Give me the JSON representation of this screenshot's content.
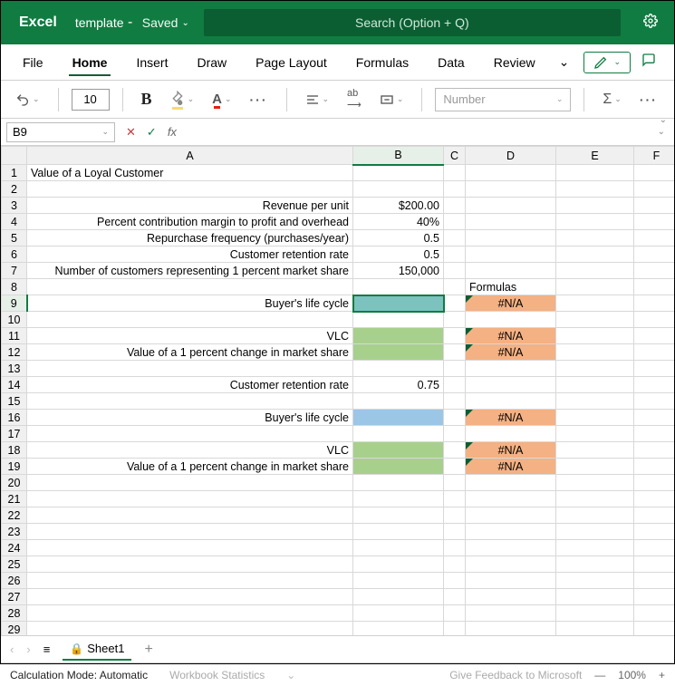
{
  "app": "Excel",
  "doc": {
    "name": "template",
    "status": "Saved"
  },
  "search": {
    "placeholder": "Search (Option + Q)"
  },
  "tabs": [
    "File",
    "Home",
    "Insert",
    "Draw",
    "Page Layout",
    "Formulas",
    "Data",
    "Review"
  ],
  "active_tab": "Home",
  "toolbar": {
    "font_size": "10",
    "number_format": "Number"
  },
  "name_box": "B9",
  "formula": "",
  "columns": [
    "A",
    "B",
    "C",
    "D",
    "E",
    "F"
  ],
  "rows": [
    {
      "n": 1,
      "A": "Value of a Loyal Customer"
    },
    {
      "n": 2
    },
    {
      "n": 3,
      "A": "Revenue per unit",
      "B": "$200.00",
      "ra": true
    },
    {
      "n": 4,
      "A": "Percent contribution margin to profit and overhead",
      "B": "40%",
      "ra": true
    },
    {
      "n": 5,
      "A": "Repurchase frequency (purchases/year)",
      "B": "0.5",
      "ra": true
    },
    {
      "n": 6,
      "A": "Customer retention rate",
      "B": "0.5",
      "ra": true
    },
    {
      "n": 7,
      "A": "Number of customers representing 1 percent market share",
      "B": "150,000",
      "ra": true
    },
    {
      "n": 8,
      "D": "Formulas"
    },
    {
      "n": 9,
      "A": "Buyer's life cycle",
      "ra": true,
      "B_fill": "teal",
      "D": "#N/A",
      "D_fill": "orange"
    },
    {
      "n": 10
    },
    {
      "n": 11,
      "A": "VLC",
      "ra": true,
      "B_fill": "green",
      "D": "#N/A",
      "D_fill": "orange"
    },
    {
      "n": 12,
      "A": "Value of a 1 percent change in market share",
      "ra": true,
      "B_fill": "green",
      "D": "#N/A",
      "D_fill": "orange"
    },
    {
      "n": 13
    },
    {
      "n": 14,
      "A": "Customer retention rate",
      "B": "0.75",
      "ra": true
    },
    {
      "n": 15
    },
    {
      "n": 16,
      "A": "Buyer's life cycle",
      "ra": true,
      "B_fill": "blue",
      "D": "#N/A",
      "D_fill": "orange"
    },
    {
      "n": 17
    },
    {
      "n": 18,
      "A": "VLC",
      "ra": true,
      "B_fill": "green",
      "D": "#N/A",
      "D_fill": "orange"
    },
    {
      "n": 19,
      "A": "Value of a 1 percent change in market share",
      "ra": true,
      "B_fill": "green",
      "D": "#N/A",
      "D_fill": "orange"
    },
    {
      "n": 20
    },
    {
      "n": 21
    },
    {
      "n": 22
    },
    {
      "n": 23
    },
    {
      "n": 24
    },
    {
      "n": 25
    },
    {
      "n": 26
    },
    {
      "n": 27
    },
    {
      "n": 28
    },
    {
      "n": 29
    }
  ],
  "selected_cell": "B9",
  "sheet_tab": "Sheet1",
  "status": {
    "calc_mode": "Calculation Mode: Automatic",
    "stats": "Workbook Statistics",
    "feedback": "Give Feedback to Microsoft",
    "zoom": "100%"
  }
}
